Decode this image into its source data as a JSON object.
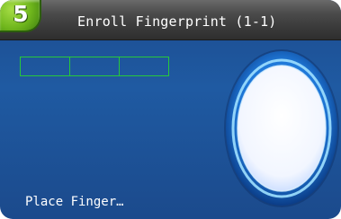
{
  "header": {
    "step_number": "5",
    "title": "Enroll Fingerprint (1-1)"
  },
  "progress": {
    "segments": 3,
    "completed": 0
  },
  "status": {
    "text": "Place Finger…"
  },
  "colors": {
    "background": "#1f5aa2",
    "title_bar": "#3a3a3a",
    "badge": "#6fb61c",
    "progress_outline": "#27c83b",
    "oval_ring": "#1f78d8",
    "oval_fill": "#ffffff"
  },
  "icons": {
    "finger_area": "fingerprint-oval-icon"
  }
}
